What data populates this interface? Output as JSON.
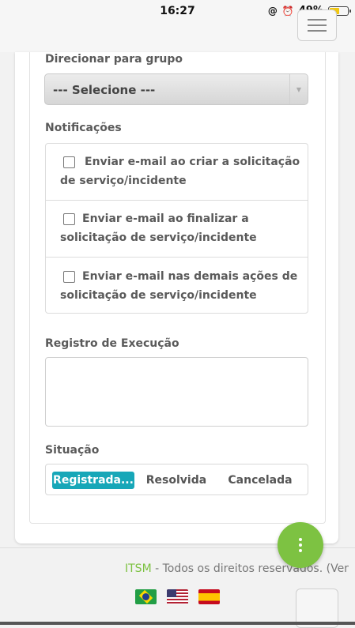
{
  "status_bar": {
    "time": "16:27",
    "battery": "49%",
    "icons": [
      "at-sign-icon",
      "alarm-icon",
      "battery-icon"
    ],
    "battery_level_fraction": 0.49
  },
  "header": {
    "menu_icon": "hamburger-icon"
  },
  "form": {
    "group_label": "Direcionar para grupo",
    "group_select_value": "--- Selecione ---",
    "notifications_label": "Notificações",
    "notifications": [
      {
        "line1": "Enviar e-mail ao criar a solicitação",
        "line2": "de serviço/incidente",
        "checked": false
      },
      {
        "line1": "Enviar e-mail ao finalizar a",
        "line2": "solicitação de serviço/incidente",
        "checked": false
      },
      {
        "line1": "Enviar e-mail nas demais ações de",
        "line2": "solicitação de serviço/incidente",
        "checked": false
      }
    ],
    "execution_label": "Registro de Execução",
    "execution_value": "",
    "status_label": "Situação",
    "status_options": [
      "Registrada...",
      "Resolvida",
      "Cancelada"
    ],
    "status_selected": "Registrada..."
  },
  "fab": {
    "icon": "more-vertical-icon"
  },
  "footer": {
    "brand": "ITSM",
    "text": " - Todos os direitos reservados. (Ver",
    "flags": [
      "brazil-flag-icon",
      "usa-flag-icon",
      "spain-flag-icon"
    ]
  },
  "colors": {
    "accent": "#17a7b8",
    "fab": "#7dc242",
    "brand": "#7dc242"
  }
}
